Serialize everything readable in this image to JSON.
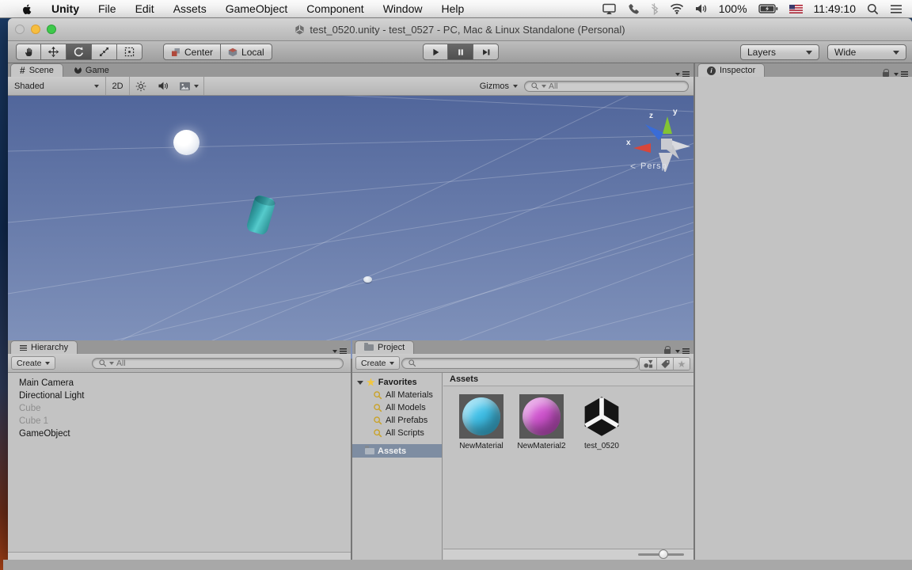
{
  "menu_bar": {
    "menus": [
      "Unity",
      "File",
      "Edit",
      "Assets",
      "GameObject",
      "Component",
      "Window",
      "Help"
    ],
    "battery_percent": "100%",
    "clock": "11:49:10"
  },
  "window_title": "test_0520.unity - test_0527 - PC, Mac & Linux Standalone (Personal)",
  "toolbar": {
    "pivot": "Center",
    "space": "Local",
    "layers": "Layers",
    "layout": "Wide"
  },
  "scene": {
    "tab_scene": "Scene",
    "tab_game": "Game",
    "draw_mode": "Shaded",
    "toggle_2d": "2D",
    "gizmos": "Gizmos",
    "search_placeholder": "All",
    "view_label": "Persp",
    "axis_x": "x",
    "axis_y": "y",
    "axis_z": "z"
  },
  "hierarchy": {
    "tab": "Hierarchy",
    "create": "Create",
    "search_placeholder": "All",
    "items": [
      {
        "label": "Main Camera",
        "enabled": true
      },
      {
        "label": "Directional Light",
        "enabled": true
      },
      {
        "label": "Cube",
        "enabled": false
      },
      {
        "label": "Cube 1",
        "enabled": false
      },
      {
        "label": "GameObject",
        "enabled": true
      }
    ]
  },
  "project": {
    "tab": "Project",
    "create": "Create",
    "favorites": "Favorites",
    "favorite_filters": [
      "All Materials",
      "All Models",
      "All Prefabs",
      "All Scripts"
    ],
    "folder": "Assets",
    "header": "Assets",
    "assets": [
      {
        "name": "NewMaterial",
        "kind": "material",
        "sphere_color": "#3fc0e8"
      },
      {
        "name": "NewMaterial2",
        "kind": "material",
        "sphere_color": "#d054cf"
      },
      {
        "name": "test_0520",
        "kind": "unity-scene"
      }
    ]
  },
  "inspector": {
    "tab": "Inspector"
  },
  "colors": {
    "sky_top": "#51669b",
    "sky_bottom": "#8294bc",
    "selection": "#7e8da2",
    "cylinder": "#3aacb0"
  }
}
